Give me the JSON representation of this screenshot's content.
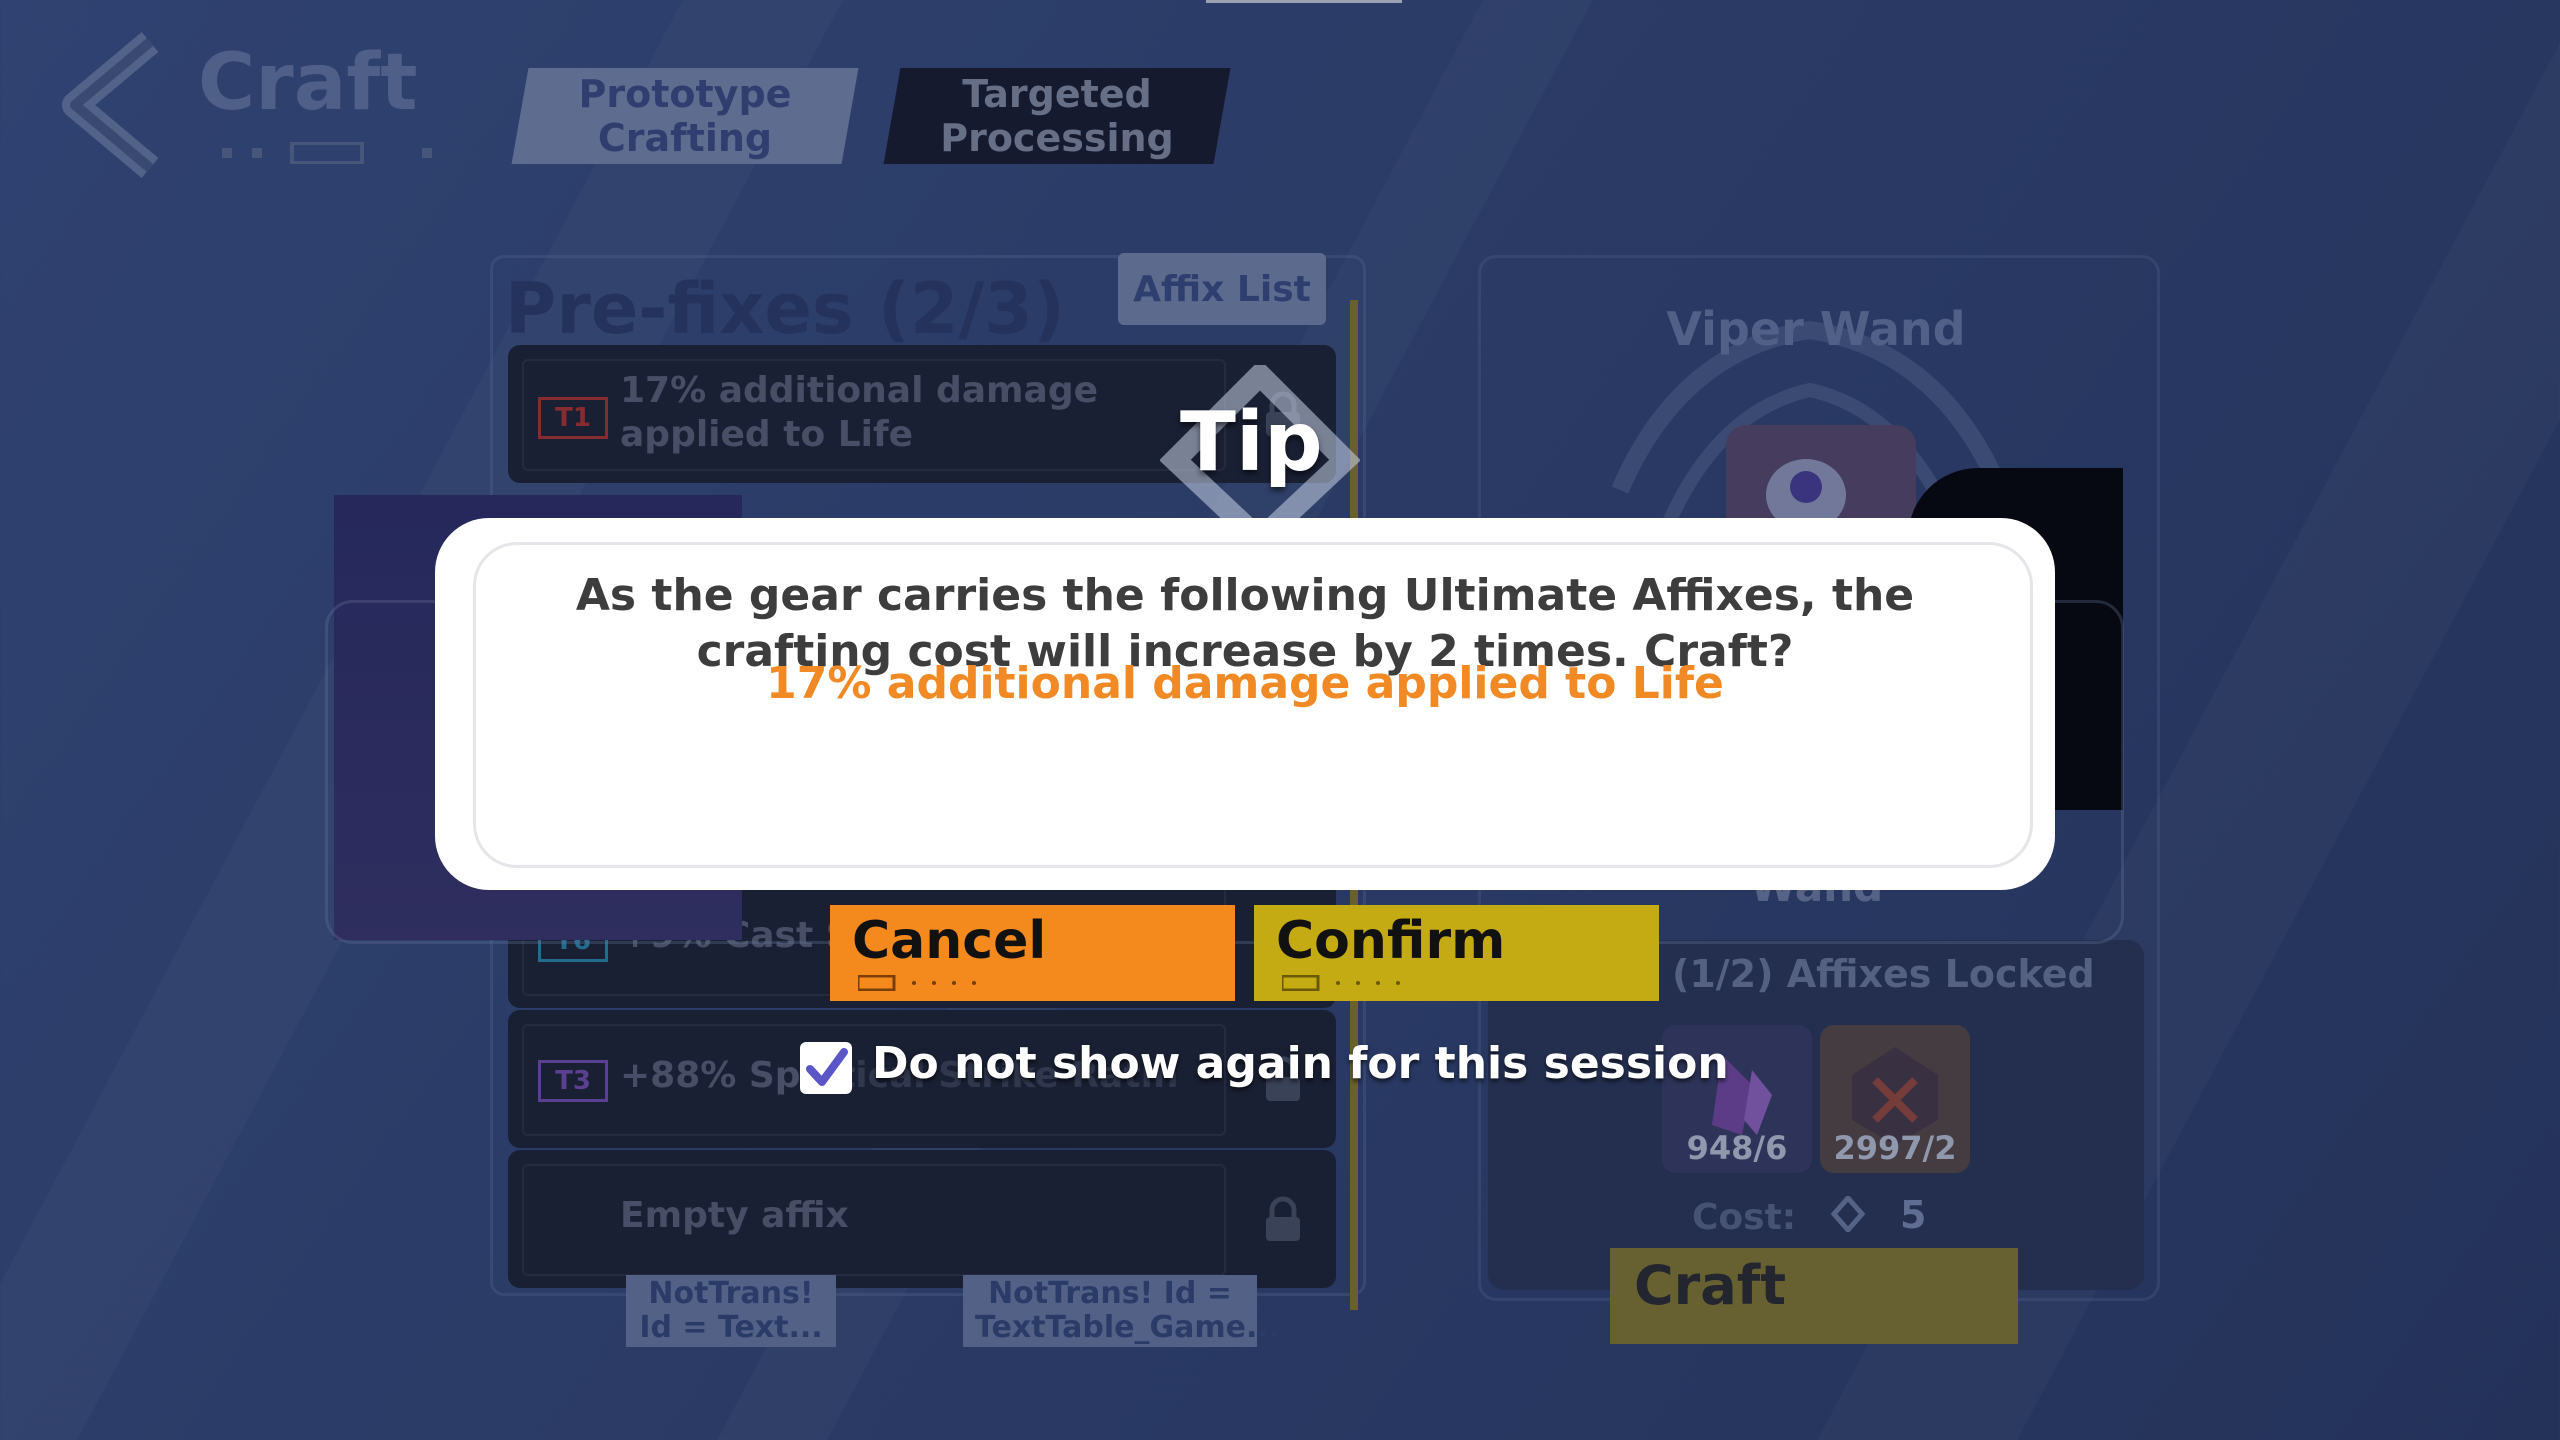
{
  "header": {
    "title": "Craft",
    "tabs": [
      {
        "label": "Prototype Crafting",
        "active": true
      },
      {
        "label": "Targeted Processing",
        "active": false
      }
    ]
  },
  "prefixes": {
    "title": "Pre-fixes (2/3)",
    "affix_list_label": "Affix List",
    "rows": [
      {
        "tier": "T1",
        "tier_color": "#b8322a",
        "text": "17% additional damage applied to Life"
      },
      {
        "tier": "T6",
        "tier_color": "#2a8fb0",
        "text": "+9% Cast Sp"
      },
      {
        "tier": "T3",
        "tier_color": "#7a4fb8",
        "text": "+88% Spe"
      },
      {
        "tier": "",
        "tier_color": "",
        "text": "Empty affix"
      }
    ],
    "partial_hidden_text": "ritical Strike Ratin"
  },
  "nottrans": [
    "NotTrans! Id = Text...",
    "NotTrans! Id = TextTable_Game..."
  ],
  "item": {
    "name": "Viper Wand",
    "partial_label": "Wand",
    "affixes_locked": "(1/2) Affixes Locked",
    "materials": [
      {
        "count": "948/6",
        "icon": "purple-crystal-icon",
        "color": "#7b4aa8"
      },
      {
        "count": "2997/2",
        "icon": "red-gem-icon",
        "color": "#a04a3a"
      }
    ],
    "cost_label": "Cost:",
    "cost_value": "5",
    "craft_label": "Craft"
  },
  "dialog": {
    "title": "Tip",
    "message": "As the gear carries the following Ultimate Affixes, the crafting cost will increase by 2 times. Craft?",
    "affix": "17% additional damage applied to Life",
    "affix_color": "#f18a25",
    "cancel_label": "Cancel",
    "confirm_label": "Confirm",
    "checkbox_label": "Do not show again for this session",
    "checkbox_checked": true
  }
}
